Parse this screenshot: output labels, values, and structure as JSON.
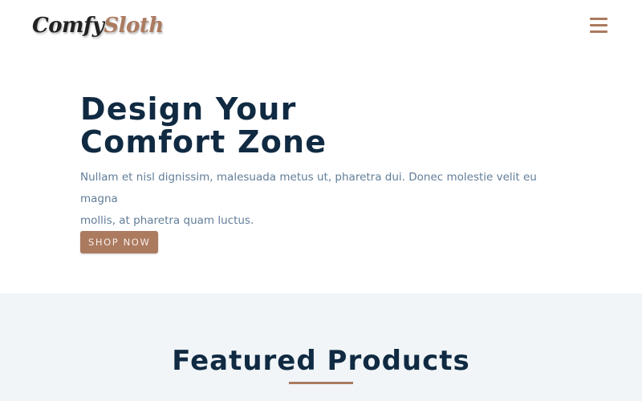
{
  "navbar": {
    "logo": {
      "part1": "Comfy",
      "part2": "Sloth"
    },
    "menu_icon": "hamburger-menu-icon"
  },
  "hero": {
    "title_line1": "Design Your",
    "title_line2": "Comfort Zone",
    "text_line1": "Nullam et nisl dignissim, malesuada metus ut, pharetra dui. Donec molestie velit eu magna",
    "text_line2": "mollis, at pharetra quam luctus.",
    "button_label": "SHOP NOW"
  },
  "featured": {
    "title": "Featured Products"
  },
  "colors": {
    "accent": "#ab7a5f",
    "heading": "#102a42",
    "body_text": "#617d98",
    "section_bg": "#f1f5f8"
  }
}
